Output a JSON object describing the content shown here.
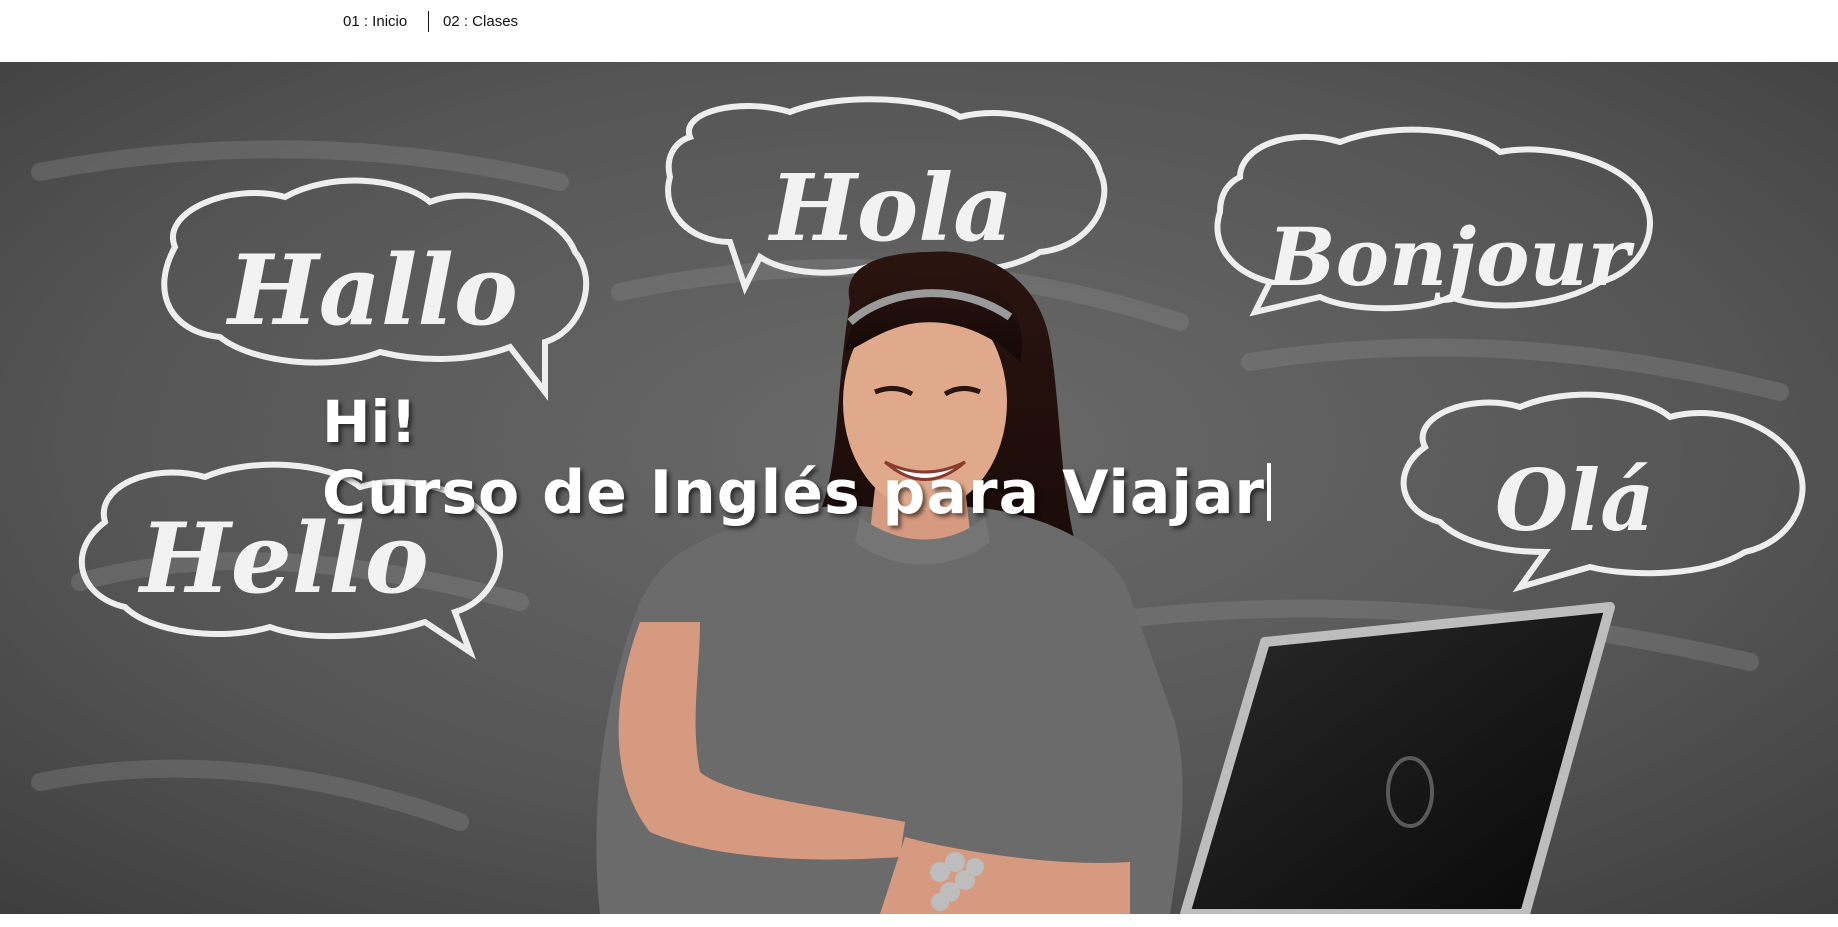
{
  "nav": {
    "items": [
      {
        "label": "01 : Inicio"
      },
      {
        "label": "02 : Clases"
      }
    ]
  },
  "hero": {
    "greeting": "Hi!",
    "title": "Curso de Inglés para Viajar",
    "bubbles": [
      "Hallo",
      "Hola",
      "Bonjour",
      "Hello",
      "Olá"
    ]
  },
  "colors": {
    "chalkboard": "#555555",
    "text": "#ffffff",
    "nav_text": "#111111"
  }
}
